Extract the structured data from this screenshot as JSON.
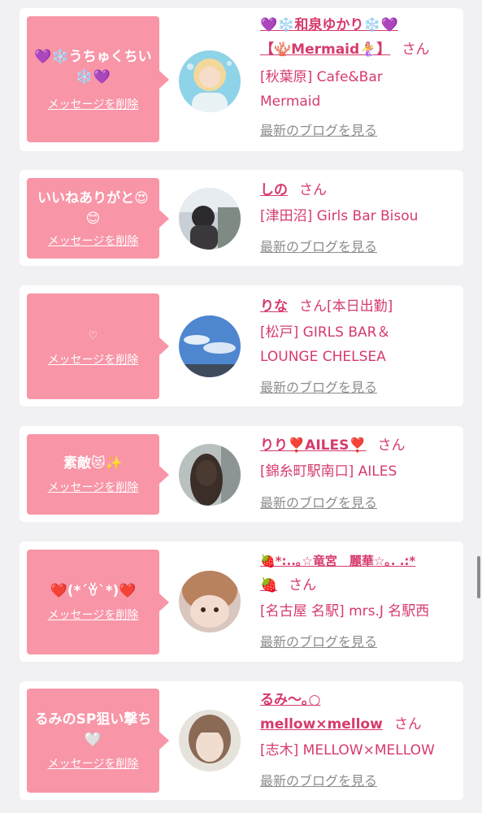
{
  "delete_label": "メッセージを削除",
  "blog_label": "最新のブログを見る",
  "entries": [
    {
      "message": "💜❄️うちゅくちい❄️💜",
      "name_line1": "💜❄️和泉ゆかり❄️💜",
      "name_line2": "【🪸Mermaid🧜‍♀️】",
      "suffix": "さん",
      "shop_line1": "[秋葉原] Cafe&Bar",
      "shop_line2": "Mermaid"
    },
    {
      "message": "いいねありがと😍😊",
      "name_line1": "しの",
      "suffix": "さん",
      "shop_line1": "[津田沼] Girls Bar Bisou"
    },
    {
      "message": "♡",
      "name_line1": "りな",
      "suffix": "さん[本日出勤]",
      "shop_line1": "[松戸] GIRLS BAR＆",
      "shop_line2": "LOUNGE CHELSEA"
    },
    {
      "message": "素敵😻✨",
      "name_line1": "りり❣️AILES❣️",
      "suffix": "さん",
      "shop_line1": "[錦糸町駅南口] AILES"
    },
    {
      "message": "❤️(*´ꈊ`*)❤️",
      "name_line1": "🍓*:..｡☆竜宮　麗華☆｡. .:*",
      "name_line2": "🍓",
      "suffix": "さん",
      "shop_line1": "[名古屋 名駅] mrs.J 名駅西"
    },
    {
      "message": "るみのSP狙い撃ち🤍",
      "name_line1": "るみ〜｡○",
      "name_line2": "mellow×mellow",
      "suffix": "さん",
      "shop_line1": "[志木] MELLOW×MELLOW"
    }
  ],
  "colors": {
    "bubble": "#f895a7",
    "name": "#d63b6c",
    "blog_link": "#8c8c8c",
    "background": "#f1f1f3"
  }
}
